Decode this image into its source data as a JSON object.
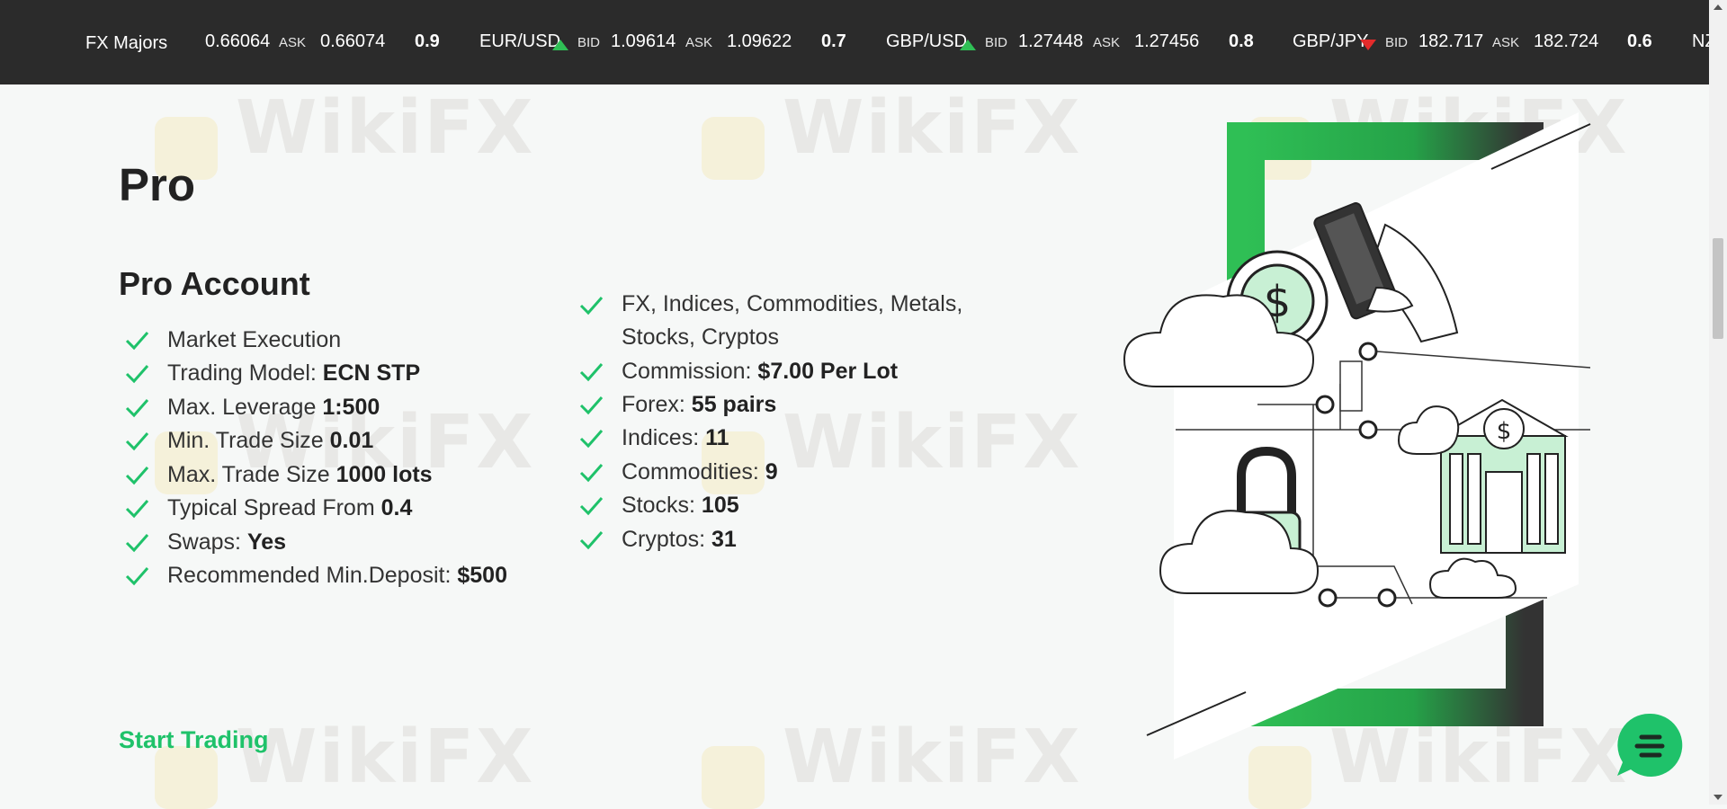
{
  "ticker": {
    "title": "FX Majors",
    "items": [
      {
        "pair": "",
        "bid_label": "",
        "bid": "0.66064",
        "ask_label": "ASK",
        "ask": "0.66074",
        "spread": "0.9",
        "direction": ""
      },
      {
        "pair": "EUR/USD",
        "bid_label": "BID",
        "bid": "1.09614",
        "ask_label": "ASK",
        "ask": "1.09622",
        "spread": "0.7",
        "direction": "up"
      },
      {
        "pair": "GBP/USD",
        "bid_label": "BID",
        "bid": "1.27448",
        "ask_label": "ASK",
        "ask": "1.27456",
        "spread": "0.8",
        "direction": "up"
      },
      {
        "pair": "GBP/JPY",
        "bid_label": "BID",
        "bid": "182.717",
        "ask_label": "ASK",
        "ask": "182.724",
        "spread": "0.6",
        "direction": "down"
      }
    ],
    "trailing": "NZ",
    "colors": {
      "up": "#2fbf55",
      "down": "#e32b2b",
      "bar": "#2b2b2b"
    }
  },
  "page": {
    "title": "Pro",
    "account_title": "Pro Account",
    "features_left": [
      {
        "label": "Market Execution",
        "value": ""
      },
      {
        "label": "Trading Model: ",
        "value": "ECN STP"
      },
      {
        "label": "Max. Leverage ",
        "value": "1:500"
      },
      {
        "label": "Min. Trade Size ",
        "value": "0.01"
      },
      {
        "label": "Max. Trade Size ",
        "value": "1000 lots"
      },
      {
        "label": "Typical Spread From ",
        "value": "0.4"
      },
      {
        "label": "Swaps: ",
        "value": "Yes"
      },
      {
        "label": "Recommended Min.Deposit: ",
        "value": "$500"
      }
    ],
    "features_right": [
      {
        "label": "FX, Indices, Commodities, Metals, Stocks, Cryptos",
        "value": ""
      },
      {
        "label": "Commission: ",
        "value": "$7.00 Per Lot"
      },
      {
        "label": "Forex: ",
        "value": "55 pairs"
      },
      {
        "label": "Indices: ",
        "value": "11"
      },
      {
        "label": "Commodities: ",
        "value": "9"
      },
      {
        "label": "Stocks: ",
        "value": "105"
      },
      {
        "label": "Cryptos: ",
        "value": "31"
      }
    ],
    "cta": "Start Trading",
    "accent": "#1fc26a"
  },
  "watermark": "WikiFX",
  "icons": {
    "check": "check-icon",
    "chat": "chat-bubble-icon"
  }
}
